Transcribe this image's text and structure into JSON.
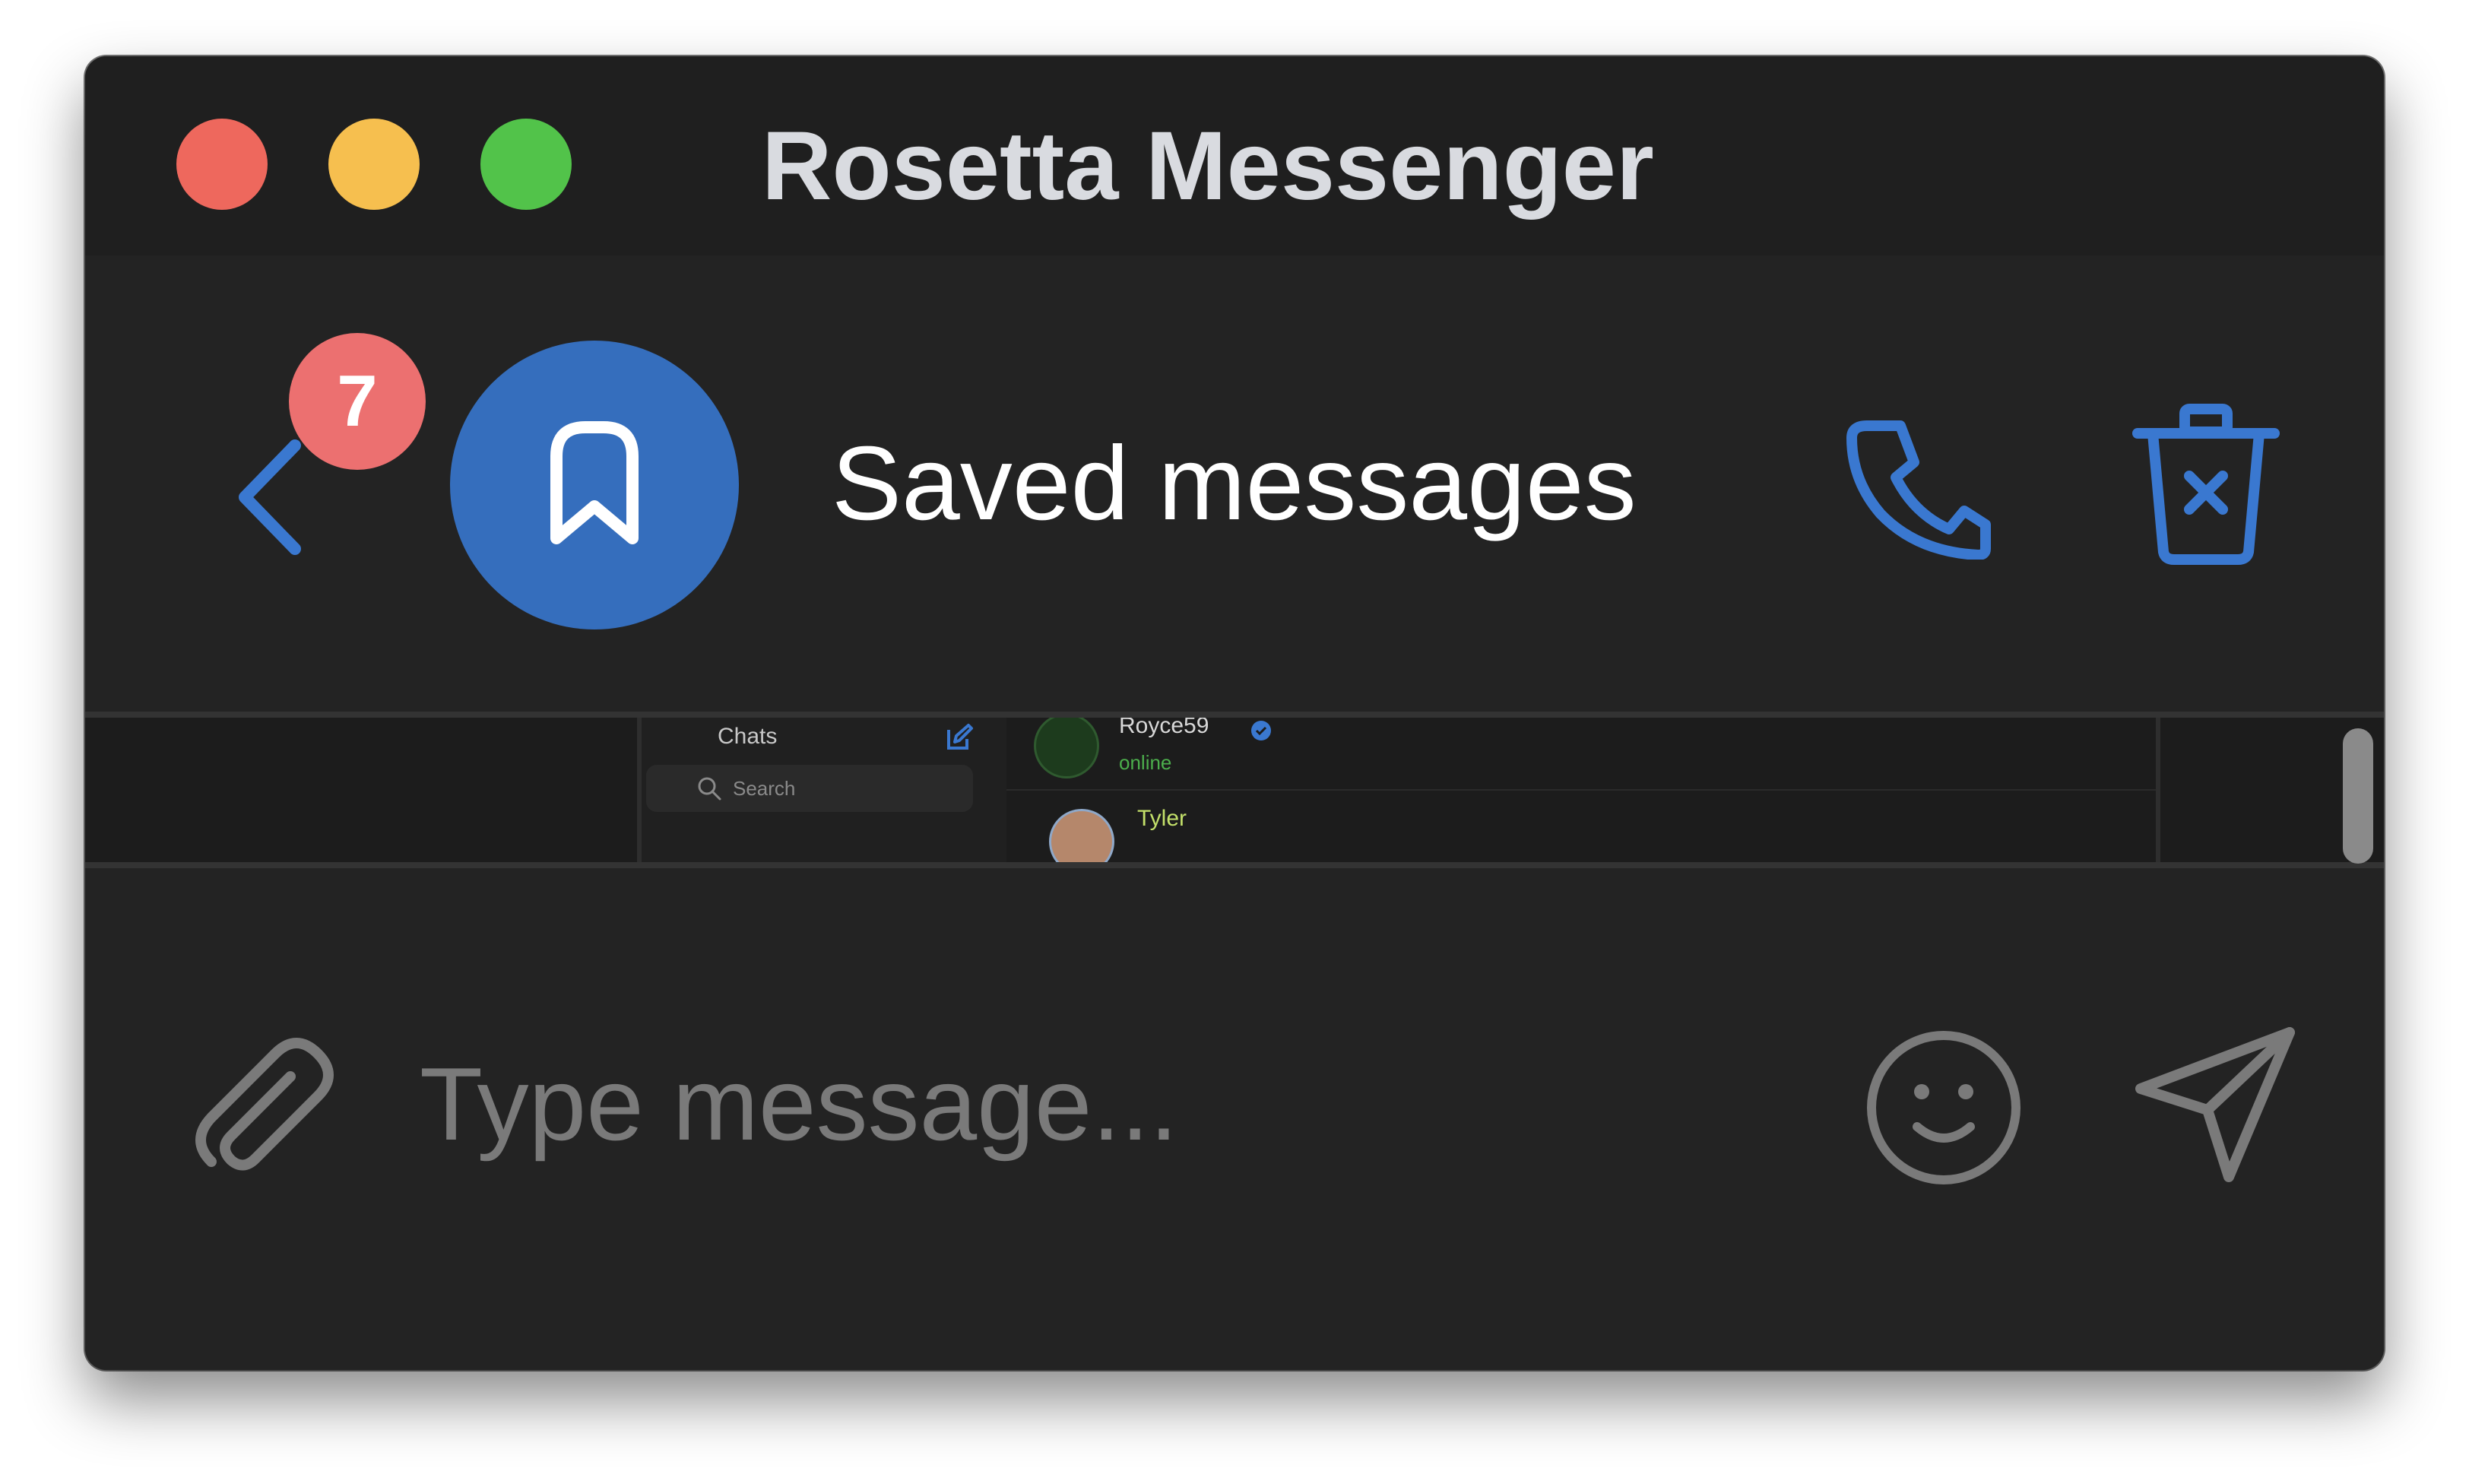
{
  "window": {
    "title": "Rosetta Messenger"
  },
  "header": {
    "unread_count": "7",
    "chat_title": "Saved messages",
    "avatar_icon": "bookmark-icon",
    "back_icon": "chevron-left-icon",
    "call_icon": "phone-icon",
    "delete_icon": "trash-x-icon"
  },
  "preview": {
    "sidebar_title": "Chats",
    "search_placeholder": "Search",
    "chats": [
      {
        "name": "Royce59",
        "status": "online",
        "verified": true
      },
      {
        "name": "Tyler"
      }
    ]
  },
  "composer": {
    "placeholder": "Type message...",
    "attach_icon": "paperclip-icon",
    "emoji_icon": "smiley-icon",
    "send_icon": "send-icon"
  },
  "colors": {
    "accent": "#356ebd",
    "icon_blue": "#3a78d0",
    "badge": "#ec7070",
    "online": "#4cae4c",
    "background": "#232323"
  }
}
